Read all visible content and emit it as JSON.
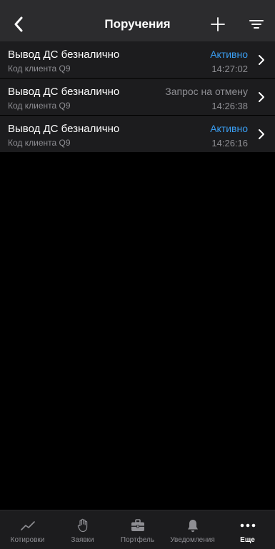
{
  "header": {
    "title": "Поручения"
  },
  "orders": [
    {
      "title": "Вывод ДС безналично",
      "client": "Код клиента Q9",
      "status": "Активно",
      "time": "14:27:02"
    },
    {
      "title": "Вывод ДС безналично",
      "client": "Код клиента Q9",
      "status": "Запрос на отмену",
      "time": "14:26:38"
    },
    {
      "title": "Вывод ДС безналично",
      "client": "Код клиента Q9",
      "status": "Активно",
      "time": "14:26:16"
    }
  ],
  "tabs": [
    {
      "label": "Котировки",
      "icon": "chart-line-icon"
    },
    {
      "label": "Заявки",
      "icon": "hand-icon"
    },
    {
      "label": "Портфель",
      "icon": "briefcase-icon"
    },
    {
      "label": "Уведомления",
      "icon": "bell-icon"
    },
    {
      "label": "Еще",
      "icon": "more-icon"
    }
  ],
  "colors": {
    "accent": "#3a9df0",
    "muted": "#8e8e93",
    "row_bg": "#1c1c1e",
    "nav_bg": "#2c2c2e"
  }
}
